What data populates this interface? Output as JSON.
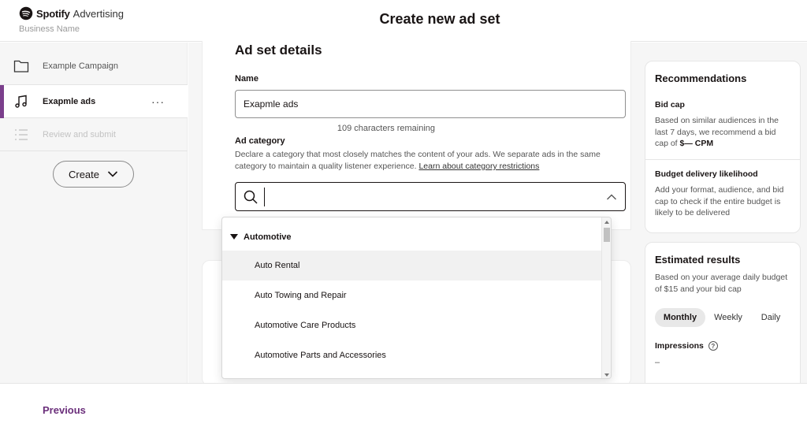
{
  "header": {
    "logo_brand": "Spotify",
    "logo_product": "Advertising",
    "business_name": "Business Name",
    "title": "Create new ad set"
  },
  "sidebar": {
    "items": [
      {
        "label": "Example Campaign",
        "icon": "folder-icon",
        "state": "default"
      },
      {
        "label": "Exapmle ads",
        "icon": "music-note-icon",
        "state": "active",
        "more": "···"
      },
      {
        "label": "Review and submit",
        "icon": "list-icon",
        "state": "disabled"
      }
    ],
    "create_label": "Create"
  },
  "form": {
    "section_title": "Ad set details",
    "name_label": "Name",
    "name_value": "Exapmle ads",
    "chars_remaining": "109 characters remaining",
    "category_label": "Ad category",
    "category_desc": "Declare a category that most closely matches the content of your ads. We separate ads in the same category to maintain a quality listener experience. ",
    "category_link": "Learn about category restrictions",
    "search_value": ""
  },
  "dropdown": {
    "group": "Automotive",
    "options": [
      "Auto Rental",
      "Auto Towing and Repair",
      "Automotive Care Products",
      "Automotive Parts and Accessories"
    ]
  },
  "recommendations": {
    "title": "Recommendations",
    "bid_cap_title": "Bid cap",
    "bid_cap_text": "Based on similar audiences in the last 7 days, we recommend a bid cap of ",
    "bid_cap_value": "$— CPM",
    "budget_title": "Budget delivery likelihood",
    "budget_text": "Add your format, audience, and bid cap to check if the entire budget is likely to be delivered"
  },
  "estimated": {
    "title": "Estimated results",
    "text": "Based on your average daily budget of $15 and your bid cap",
    "periods": [
      "Monthly",
      "Weekly",
      "Daily"
    ],
    "selected_period": "Monthly",
    "impressions_label": "Impressions",
    "impressions_value": "–"
  },
  "footer": {
    "previous_label": "Previous"
  },
  "colors": {
    "accent": "#7b3f8c",
    "previous_text": "#6b2f7b",
    "background": "#f6f6f6"
  }
}
